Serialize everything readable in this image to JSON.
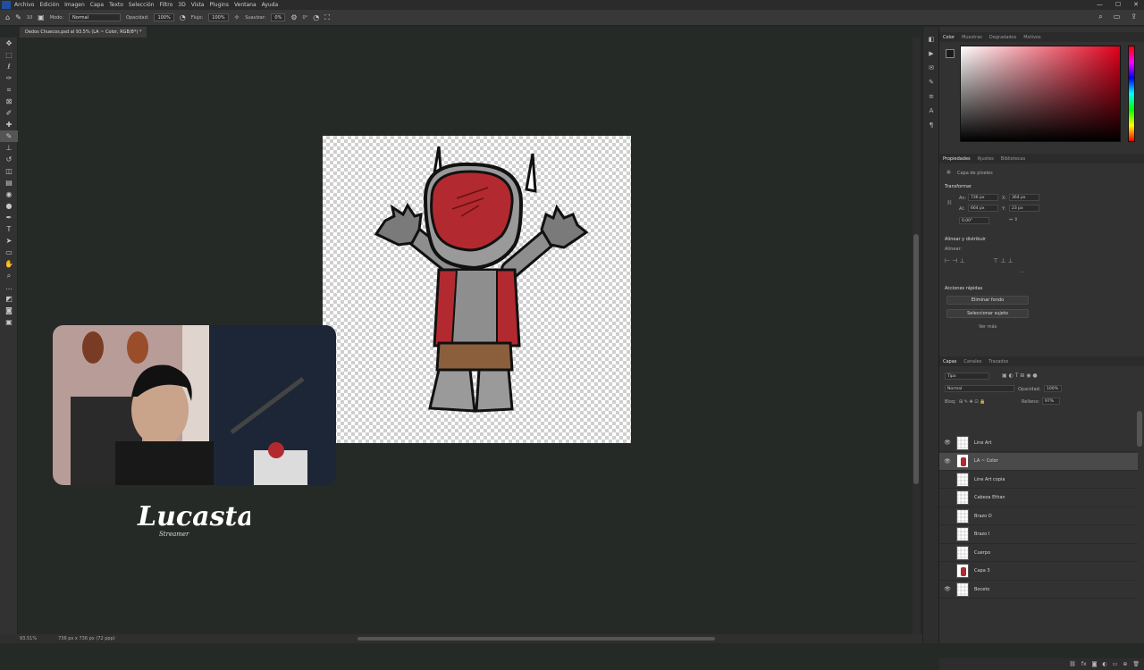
{
  "menubar": {
    "items": [
      "Archivo",
      "Edición",
      "Imagen",
      "Capa",
      "Texto",
      "Selección",
      "Filtro",
      "3D",
      "Vista",
      "Plugins",
      "Ventana",
      "Ayuda"
    ],
    "window_controls": [
      "—",
      "☐",
      "✕"
    ]
  },
  "options": {
    "mode_label": "Modo:",
    "mode_value": "Normal",
    "opacity_label": "Opacidad:",
    "opacity_value": "100%",
    "flow_label": "Flujo:",
    "flow_value": "100%",
    "smoothing_label": "Suavizar:",
    "smoothing_value": "0%",
    "angle_value": "0°",
    "brush_size": "10"
  },
  "document": {
    "tab_title": "Dedos Chuecos.psd al 93.5% (LA ~ Color, RGB/8*) *",
    "zoom": "93.51%",
    "doc_size": "736 px x 736 px (72 ppp)"
  },
  "streamer": {
    "name": "Lucasta",
    "subtitle": "Streamer"
  },
  "color_panel": {
    "tabs": [
      "Color",
      "Muestras",
      "Degradados",
      "Motivos"
    ],
    "active": "Color"
  },
  "properties_panel": {
    "tabs": [
      "Propiedades",
      "Ajustes",
      "Bibliotecas"
    ],
    "layer_type": "Capa de píxeles",
    "transform_heading": "Transformar",
    "w_label": "An:",
    "w_value": "736 px",
    "x_label": "X:",
    "x_value": "364 px",
    "h_label": "Al:",
    "h_value": "664 px",
    "y_label": "Y:",
    "y_value": "23 px",
    "angle_value": "0,00°",
    "align_heading": "Alinear y distribuir",
    "align_sub": "Alinear:",
    "quick_actions_heading": "Acciones rápidas",
    "btn_remove_bg": "Eliminar fondo",
    "btn_select_subject": "Seleccionar sujeto",
    "more_link": "Ver más"
  },
  "layers_panel": {
    "tabs": [
      "Capas",
      "Canales",
      "Trazados"
    ],
    "filter_label": "Tipo",
    "blend_mode": "Normal",
    "opacity_label": "Opacidad:",
    "opacity_value": "100%",
    "lock_label": "Bloq:",
    "fill_label": "Relleno:",
    "fill_value": "97%",
    "layers": [
      {
        "name": "Line Art",
        "visible": true,
        "selected": false,
        "thumb": "checker"
      },
      {
        "name": "LA ~ Color",
        "visible": true,
        "selected": true,
        "thumb": "red"
      },
      {
        "name": "Line Art copia",
        "visible": false,
        "selected": false,
        "thumb": "checker"
      },
      {
        "name": "Cabeza Ethan",
        "visible": false,
        "selected": false,
        "thumb": "checker"
      },
      {
        "name": "Brazo D",
        "visible": false,
        "selected": false,
        "thumb": "checker"
      },
      {
        "name": "Brazo I",
        "visible": false,
        "selected": false,
        "thumb": "checker"
      },
      {
        "name": "Cuerpo",
        "visible": false,
        "selected": false,
        "thumb": "checker"
      },
      {
        "name": "Capa 3",
        "visible": false,
        "selected": false,
        "thumb": "red"
      },
      {
        "name": "Boceto",
        "visible": true,
        "selected": false,
        "thumb": "checker"
      }
    ]
  },
  "colors": {
    "accent_red": "#b22a2f",
    "canvas_bg": "#262a26",
    "panel_bg": "#323232"
  }
}
